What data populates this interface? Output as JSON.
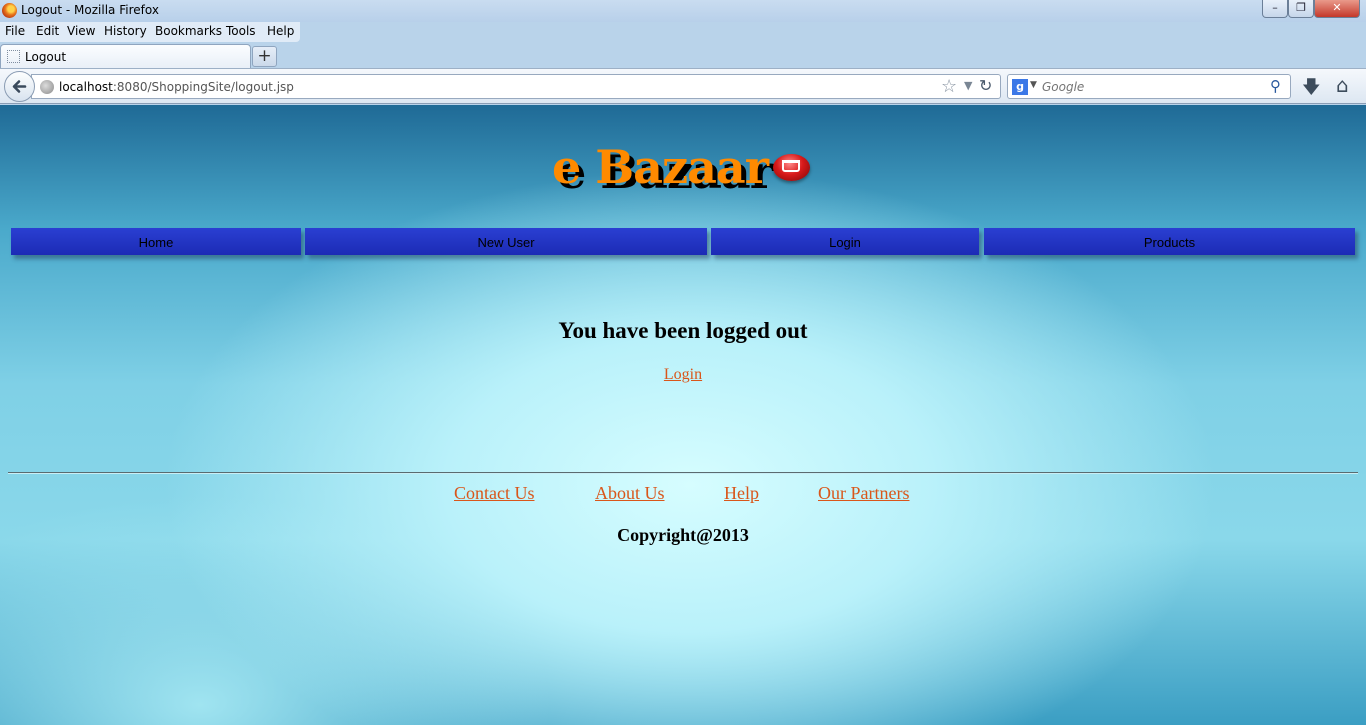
{
  "window": {
    "title": "Logout - Mozilla Firefox",
    "minimize": "–",
    "maximize": "❐",
    "close": "✕"
  },
  "menubar": {
    "file": "File",
    "edit": "Edit",
    "view": "View",
    "history": "History",
    "bookmarks": "Bookmarks",
    "tools": "Tools",
    "help": "Help"
  },
  "tabs": [
    {
      "label": "Logout",
      "active": true
    }
  ],
  "newtab_label": "+",
  "navbar": {
    "url_host": "localhost",
    "url_rest": ":8080/ShoppingSite/logout.jsp",
    "search_placeholder": "Google",
    "search_engine_letter": "g",
    "icons": {
      "back": "back-arrow-icon",
      "star": "bookmark-star-icon",
      "reload": "reload-icon",
      "search": "magnifier-icon",
      "download": "download-icon",
      "home": "home-icon"
    }
  },
  "site": {
    "logo_text": "e Bazaar",
    "logo_colors": {
      "main": "#ff8a00",
      "shadow": "#000000"
    },
    "nav": {
      "home": "Home",
      "new_user": "New User",
      "login": "Login",
      "products": "Products"
    },
    "nav_color": "#2233c8",
    "heading": "You have been logged out",
    "login_link": "Login",
    "link_color": "#d9561a",
    "footer": {
      "contact_us": "Contact Us",
      "about_us": "About Us",
      "help": "Help",
      "our_partners": "Our Partners",
      "copyright": "Copyright@2013"
    }
  }
}
